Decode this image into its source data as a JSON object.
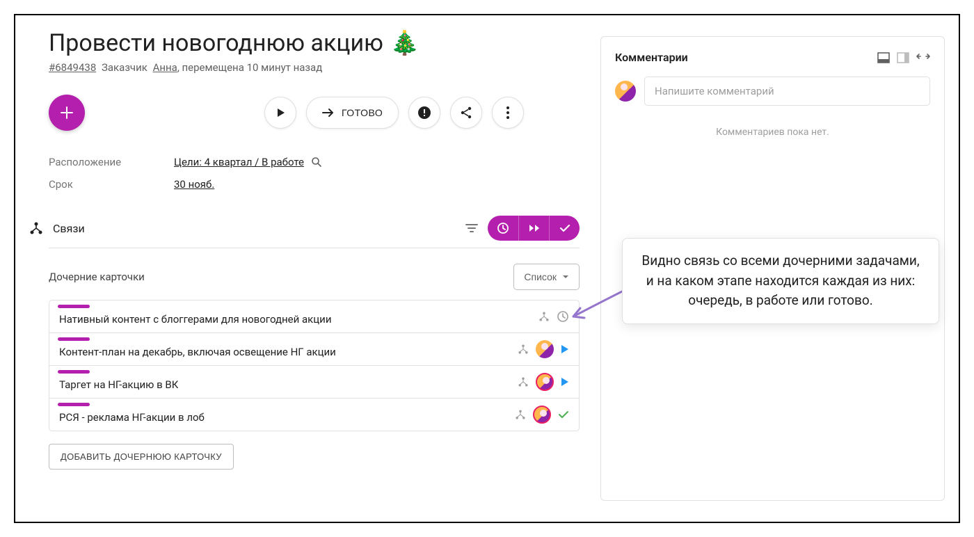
{
  "task": {
    "title": "Провести новогоднюю акцию",
    "emoji": "🎄",
    "id": "#6849438",
    "owner_label": "Заказчик",
    "owner_name": "Анна",
    "moved_text": ", перемещена 10 минут назад"
  },
  "actions": {
    "done_label": "ГОТОВО"
  },
  "meta": {
    "location_label": "Расположение",
    "location_value": "Цели: 4 квартал / В работе",
    "deadline_label": "Срок",
    "deadline_value": "30 нояб."
  },
  "links": {
    "section_title": "Связи",
    "child_title": "Дочерние карточки",
    "view_mode": "Список",
    "add_button": "ДОБАВИТЬ ДОЧЕРНЮЮ КАРТОЧКУ",
    "items": [
      {
        "title": "Нативный контент с блоггерами для новогодней акции",
        "status": "queue",
        "avatar": false
      },
      {
        "title": "Контент-план на декабрь, включая освещение НГ акции",
        "status": "progress",
        "avatar": true,
        "ring": false
      },
      {
        "title": "Таргет на НГ-акцию в ВК",
        "status": "progress",
        "avatar": true,
        "ring": true
      },
      {
        "title": "РСЯ - реклама НГ-акции в лоб",
        "status": "done",
        "avatar": true,
        "ring": true
      }
    ]
  },
  "comments": {
    "title": "Комментарии",
    "placeholder": "Напишите комментарий",
    "empty": "Комментариев пока нет."
  },
  "callout": {
    "text": "Видно связь со всеми дочерними задачами, и на каком этапе находится каждая из них: очередь, в работе или готово."
  }
}
